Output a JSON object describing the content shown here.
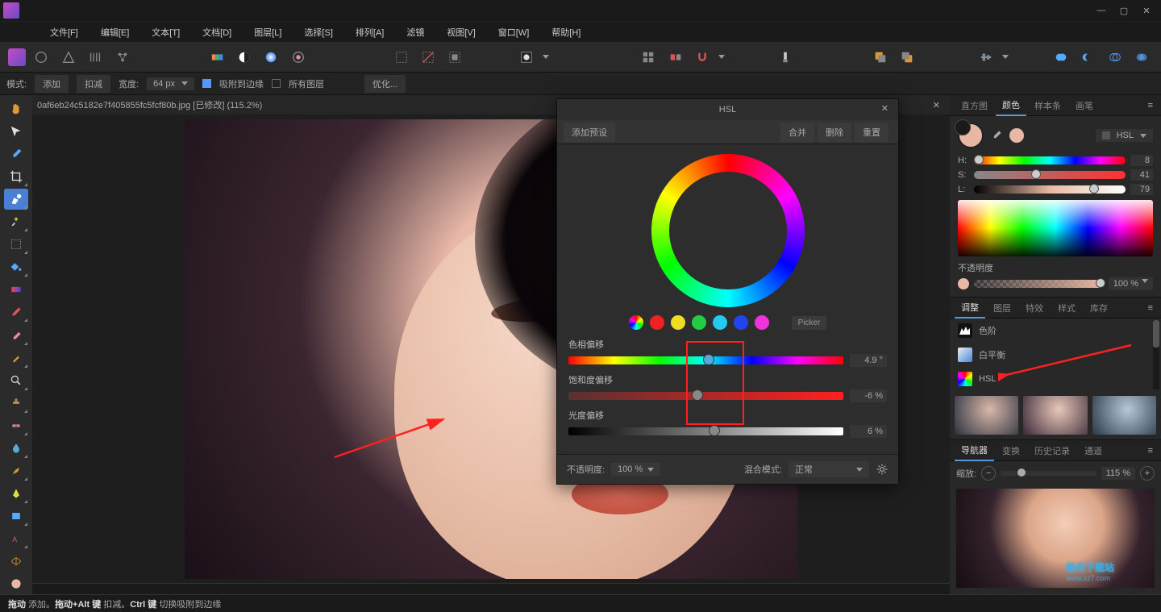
{
  "menubar": [
    "文件[F]",
    "编辑[E]",
    "文本[T]",
    "文档[D]",
    "图层[L]",
    "选择[S]",
    "排列[A]",
    "滤镜",
    "视图[V]",
    "窗口[W]",
    "帮助[H]"
  ],
  "optionbar": {
    "mode_label": "模式:",
    "add": "添加",
    "sub": "扣减",
    "width_label": "宽度:",
    "width_val": "64 px",
    "snap": "吸附到边缘",
    "all_layers": "所有图层",
    "optimize": "优化..."
  },
  "document_tab": "0af6eb24c5182e7f405855fc5fcf80b.jpg [已修改] (115.2%)",
  "hsl_dialog": {
    "title": "HSL",
    "add_preset": "添加预设",
    "merge": "合并",
    "delete": "删除",
    "reset": "重置",
    "picker": "Picker",
    "hue_label": "色相偏移",
    "hue_val": "4.9 °",
    "sat_label": "饱和度偏移",
    "sat_val": "-6 %",
    "lig_label": "光度偏移",
    "lig_val": "6 %",
    "opacity_label": "不透明度:",
    "opacity_val": "100 %",
    "blend_label": "混合模式:",
    "blend_val": "正常"
  },
  "right_panel": {
    "tabs1": [
      "直方图",
      "颜色",
      "样本条",
      "画笔"
    ],
    "hsl_sel": "HSL",
    "h_label": "H:",
    "h_val": "8",
    "s_label": "S:",
    "s_val": "41",
    "l_label": "L:",
    "l_val": "79",
    "opacity_label": "不透明度",
    "opacity_val": "100 %",
    "tabs2": [
      "调整",
      "图层",
      "特效",
      "样式",
      "库存"
    ],
    "adj_levels": "色阶",
    "adj_wb": "白平衡",
    "adj_hsl": "HSL",
    "tabs3": [
      "导航器",
      "变换",
      "历史记录",
      "通道"
    ],
    "zoom_label": "缩放:",
    "zoom_val": "115 %"
  },
  "status": {
    "drag": "拖动",
    "add": " 添加。",
    "dragalt": "拖动+Alt 键",
    " sub": " 扣减。",
    "ctrl": "Ctrl 键",
    " toggle": " 切换吸附到边缘"
  },
  "watermark": {
    "name": "极光下载站",
    "url": "www.xz7.com"
  }
}
